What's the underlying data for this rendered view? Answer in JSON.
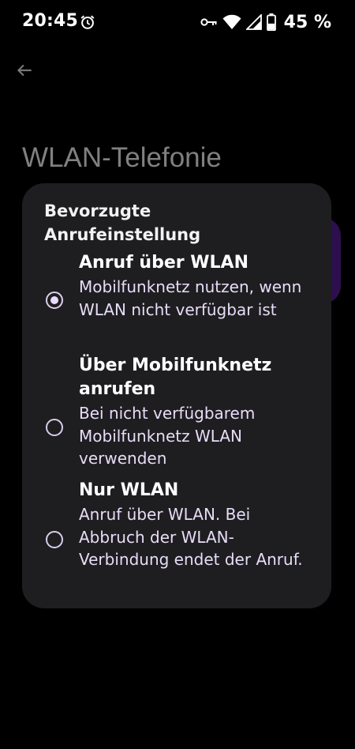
{
  "status_bar": {
    "time": "20:45",
    "battery_percent": "45 %",
    "battery_level": 0.45,
    "icons": [
      "alarm-icon",
      "vpn-key-icon",
      "wifi-icon",
      "signal-icon",
      "battery-icon"
    ]
  },
  "background": {
    "title": "WLAN-Telefonie"
  },
  "dialog": {
    "title": "Bevorzugte\nAnrufeinstellung",
    "options": [
      {
        "label": "Anruf über WLAN",
        "description": "Mobilfunknetz nutzen, wenn WLAN nicht verfügbar ist",
        "checked": true
      },
      {
        "label": "Über Mobilfunknetz anrufen",
        "description": "Bei nicht verfügbarem Mobilfunknetz WLAN verwenden",
        "checked": false
      },
      {
        "label": "Nur WLAN",
        "description": "Anruf über WLAN. Bei Abbruch der WLAN-Verbindung endet der Anruf.",
        "checked": false
      }
    ]
  },
  "colors": {
    "dialog_bg": "#1e1e20",
    "accent": "#e9dcff",
    "card_bg": "#2e0f4d"
  }
}
